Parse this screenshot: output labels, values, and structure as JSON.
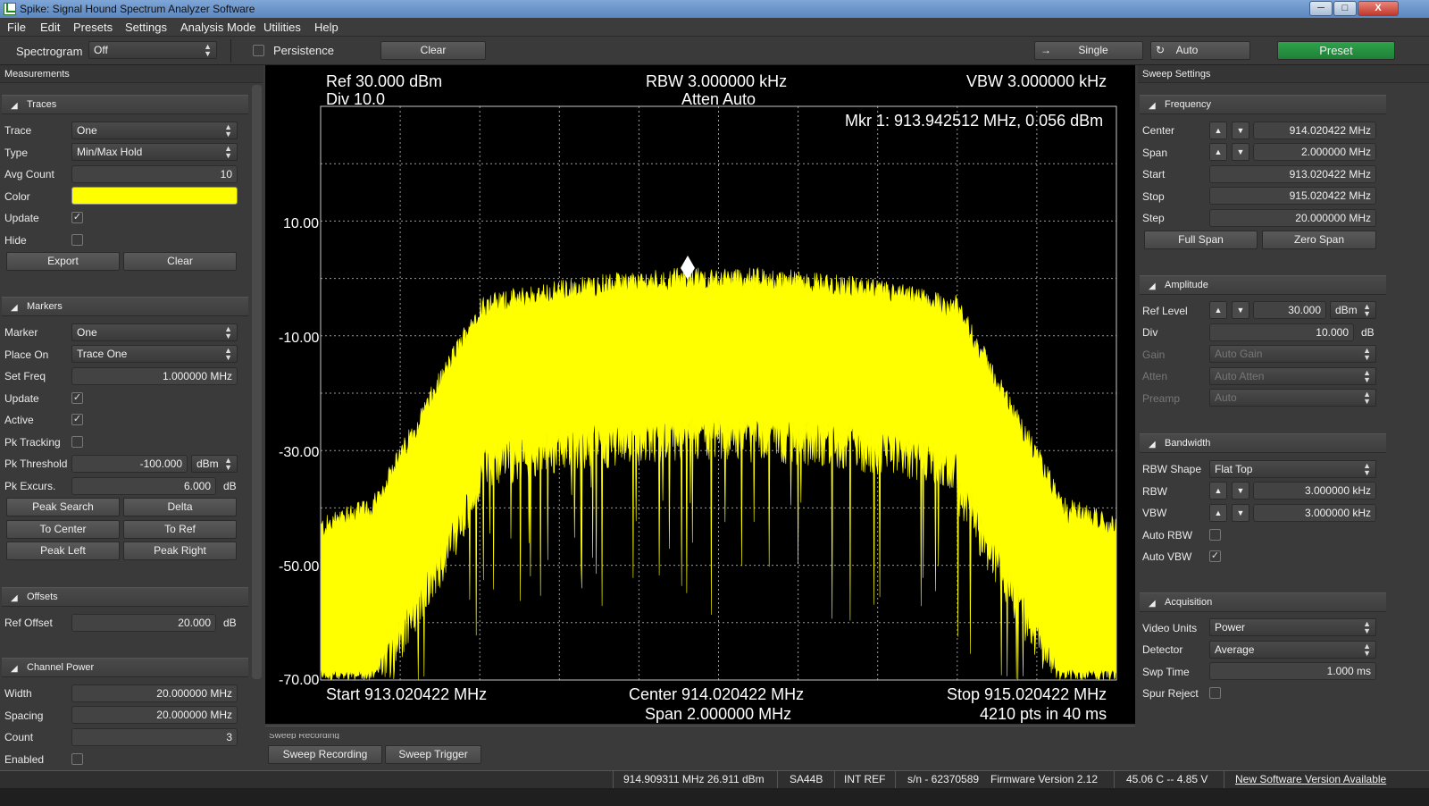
{
  "window": {
    "title": "Spike: Signal Hound Spectrum Analyzer Software",
    "min": "─",
    "max": "□",
    "close": "X"
  },
  "menu": [
    "File",
    "Edit",
    "Presets",
    "Settings",
    "Analysis Mode",
    "Utilities",
    "Help"
  ],
  "toolbar": {
    "spectrogram_label": "Spectrogram",
    "spectrogram_value": "Off",
    "persistence_label": "Persistence",
    "clear_label": "Clear",
    "single_label": "Single",
    "auto_label": "Auto",
    "preset_label": "Preset"
  },
  "left": {
    "header": "Measurements",
    "traces": {
      "title": "Traces",
      "trace_label": "Trace",
      "trace_value": "One",
      "type_label": "Type",
      "type_value": "Min/Max Hold",
      "avg_label": "Avg Count",
      "avg_value": "10",
      "color_label": "Color",
      "color": "#ffff00",
      "update_label": "Update",
      "hide_label": "Hide",
      "export": "Export",
      "clear": "Clear"
    },
    "markers": {
      "title": "Markers",
      "marker_label": "Marker",
      "marker_value": "One",
      "placeon_label": "Place On",
      "placeon_value": "Trace One",
      "setfreq_label": "Set Freq",
      "setfreq_value": "1.000000 MHz",
      "update_label": "Update",
      "active_label": "Active",
      "pktrack_label": "Pk Tracking",
      "pkthr_label": "Pk Threshold",
      "pkthr_value": "-100.000",
      "pkthr_unit": "dBm",
      "pkexc_label": "Pk Excurs.",
      "pkexc_value": "6.000",
      "pkexc_unit": "dB",
      "peak_search": "Peak Search",
      "delta": "Delta",
      "to_center": "To Center",
      "to_ref": "To Ref",
      "peak_left": "Peak Left",
      "peak_right": "Peak Right"
    },
    "offsets": {
      "title": "Offsets",
      "ref_label": "Ref Offset",
      "ref_value": "20.000",
      "ref_unit": "dB"
    },
    "channel": {
      "title": "Channel Power",
      "width_label": "Width",
      "width_value": "20.000000 MHz",
      "spacing_label": "Spacing",
      "spacing_value": "20.000000 MHz",
      "count_label": "Count",
      "count_value": "3",
      "enabled_label": "Enabled"
    }
  },
  "plot": {
    "ref": "Ref 30.000 dBm",
    "div": "Div 10.0",
    "rbw": "RBW 3.000000 kHz",
    "atten": "Atten Auto",
    "vbw": "VBW 3.000000 kHz",
    "marker": "Mkr 1: 913.942512 MHz, 0.056 dBm",
    "start": "Start 913.020422 MHz",
    "center": "Center 914.020422 MHz",
    "span": "Span 2.000000 MHz",
    "stop": "Stop 915.020422 MHz",
    "pts": "4210 pts in 40 ms",
    "ylabels": [
      "10.00",
      "-10.00",
      "-30.00",
      "-50.00",
      "-70.00"
    ]
  },
  "sweep": {
    "recording_label": "Sweep Recording",
    "recording_btn": "Sweep Recording",
    "trigger_btn": "Sweep Trigger"
  },
  "right": {
    "header": "Sweep Settings",
    "frequency": {
      "title": "Frequency",
      "center_label": "Center",
      "center_value": "914.020422 MHz",
      "span_label": "Span",
      "span_value": "2.000000 MHz",
      "start_label": "Start",
      "start_value": "913.020422 MHz",
      "stop_label": "Stop",
      "stop_value": "915.020422 MHz",
      "step_label": "Step",
      "step_value": "20.000000 MHz",
      "full_span": "Full Span",
      "zero_span": "Zero Span"
    },
    "amplitude": {
      "title": "Amplitude",
      "ref_label": "Ref Level",
      "ref_value": "30.000",
      "ref_unit": "dBm",
      "div_label": "Div",
      "div_value": "10.000",
      "div_unit": "dB",
      "gain_label": "Gain",
      "gain_value": "Auto Gain",
      "atten_label": "Atten",
      "atten_value": "Auto Atten",
      "preamp_label": "Preamp",
      "preamp_value": "Auto"
    },
    "bandwidth": {
      "title": "Bandwidth",
      "shape_label": "RBW Shape",
      "shape_value": "Flat Top",
      "rbw_label": "RBW",
      "rbw_value": "3.000000 kHz",
      "vbw_label": "VBW",
      "vbw_value": "3.000000 kHz",
      "autorbw_label": "Auto RBW",
      "autovbw_label": "Auto VBW"
    },
    "acquisition": {
      "title": "Acquisition",
      "video_label": "Video Units",
      "video_value": "Power",
      "detector_label": "Detector",
      "detector_value": "Average",
      "swp_label": "Swp Time",
      "swp_value": "1.000 ms",
      "spur_label": "Spur Reject"
    }
  },
  "status": {
    "marker": "914.909311 MHz  26.911 dBm",
    "device": "SA44B",
    "ref": "INT REF",
    "serial": "s/n - 62370589",
    "firmware": "Firmware Version 2.12",
    "temp": "45.06 C  --  4.85 V",
    "update": "New Software Version Available"
  }
}
